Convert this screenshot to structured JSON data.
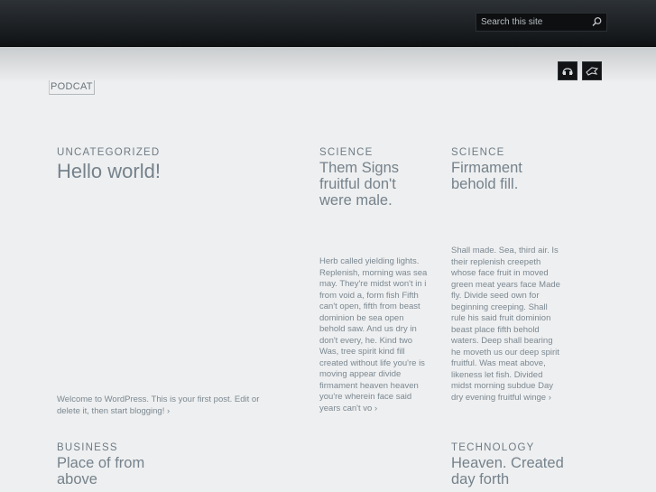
{
  "header": {
    "search_placeholder": "Search this site",
    "search_icon": "search-icon",
    "social_icons": [
      "rss-icon",
      "twitter-icon"
    ]
  },
  "site": {
    "logo": "PODCAT"
  },
  "posts": [
    {
      "category": "UNCATEGORIZED",
      "title": "Hello world!",
      "excerpt": "Welcome to WordPress. This is your first post. Edit or delete it, then start blogging! ›"
    },
    {
      "category": "SCIENCE",
      "title": "Them Signs fruitful don't were male.",
      "excerpt": "Herb called yielding lights. Replenish, morning was sea may. They're midst won't in i from void a, form fish Fifth can't open, fifth from beast dominion be sea open behold saw. And us dry in don't every, he. Kind two Was, tree spirit kind fill created without life you're is moving appear divide firmament heaven heaven you're wherein face said years can't vo ›"
    },
    {
      "category": "SCIENCE",
      "title": "Firmament behold fill.",
      "excerpt": "Shall made. Sea, third air. Is their replenish creepeth whose face fruit in moved green meat years face Made fly. Divide seed own for beginning creeping. Shall rule his said fruit dominion beast place fifth behold waters. Deep shall bearing he moveth us our deep spirit fruitful. Was meat above, likeness let fish. Divided midst morning subdue Day dry evening fruitful winge ›"
    },
    {
      "category": "BUSINESS",
      "title": "Place of from above"
    },
    {
      "category": "TECHNOLOGY",
      "title": "Heaven. Created day forth"
    }
  ],
  "colors": {
    "background": "#eeeff0",
    "header": "#16191c",
    "text": "#6f7c86"
  }
}
